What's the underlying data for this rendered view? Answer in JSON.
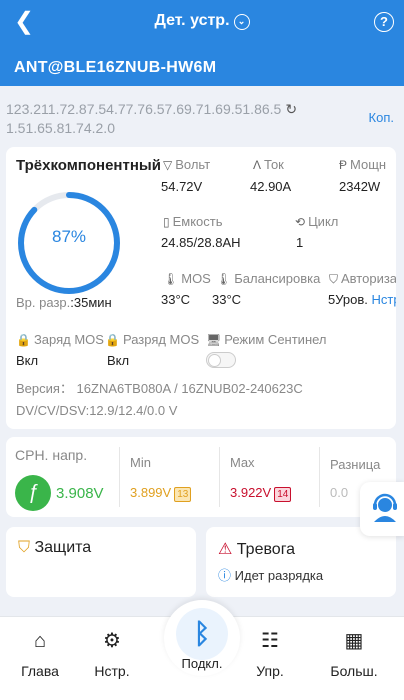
{
  "header": {
    "title": "Дет. устр.",
    "device_name": "ANT@BLE16ZNUB-HW6M",
    "back_icon": "chevron-left-icon",
    "help_icon": "question-circle-icon",
    "background": "#2a86e0"
  },
  "connection": {
    "ip_line1": "123.211.72.87.54.77.76.57.69.71.69.51.86.5",
    "ip_line2": "1.51.65.81.74.2.0",
    "copy_label": "Коп."
  },
  "battery": {
    "type": "Трёхкомпонентный",
    "soc": 0.87,
    "soc_text": "87%",
    "discharge_time_label": "Вр. разр.",
    "discharge_time_value": ":35мин",
    "voltage_label": "Вольт",
    "voltage_value": "54.72V",
    "current_label": "Ток",
    "current_value": "42.90A",
    "power_label": "Мощн",
    "power_value": "2342W",
    "capacity_label": "Емкость",
    "capacity_value": "24.85/28.8AH",
    "cycle_label": "Цикл",
    "cycle_value": "1",
    "mos_label": "MOS",
    "mos_value": "33°C",
    "balance_label": "Балансировка",
    "balance_value": "33°C",
    "auth_label": "Авториза",
    "auth_value": "5Уров.",
    "auth_link": "Нстр",
    "charge_mos_label": "Заряд MOS",
    "charge_mos_value": "Вкл",
    "discharge_mos_label": "Разряд MOS",
    "discharge_mos_value": "Вкл",
    "sentinel_label": "Режим Сентинел",
    "version_text": "Версия：  16ZNA6TB080A / 16ZNUB02-240623C",
    "dv_text": "DV/CV/DSV:12.9/12.4/0.0 V"
  },
  "cells": {
    "avg_label": "СРН. напр.",
    "avg_value": "3.908V",
    "min_label": "Min",
    "min_value": "3.899V",
    "min_cell": "13",
    "max_label": "Max",
    "max_value": "3.922V",
    "max_cell": "14",
    "diff_label": "Разница",
    "diff_value": "0.0",
    "colors": {
      "avg": "#3ab54a",
      "min": "#e0a020",
      "max": "#c8102e"
    }
  },
  "protection": {
    "title": "Защита"
  },
  "alarm": {
    "title": "Тревога",
    "item1": "Идет разрядка"
  },
  "nav": {
    "home": "Глава",
    "settings": "Нстр.",
    "connect": "Подкл.",
    "control": "Упр.",
    "more": "Больш."
  }
}
